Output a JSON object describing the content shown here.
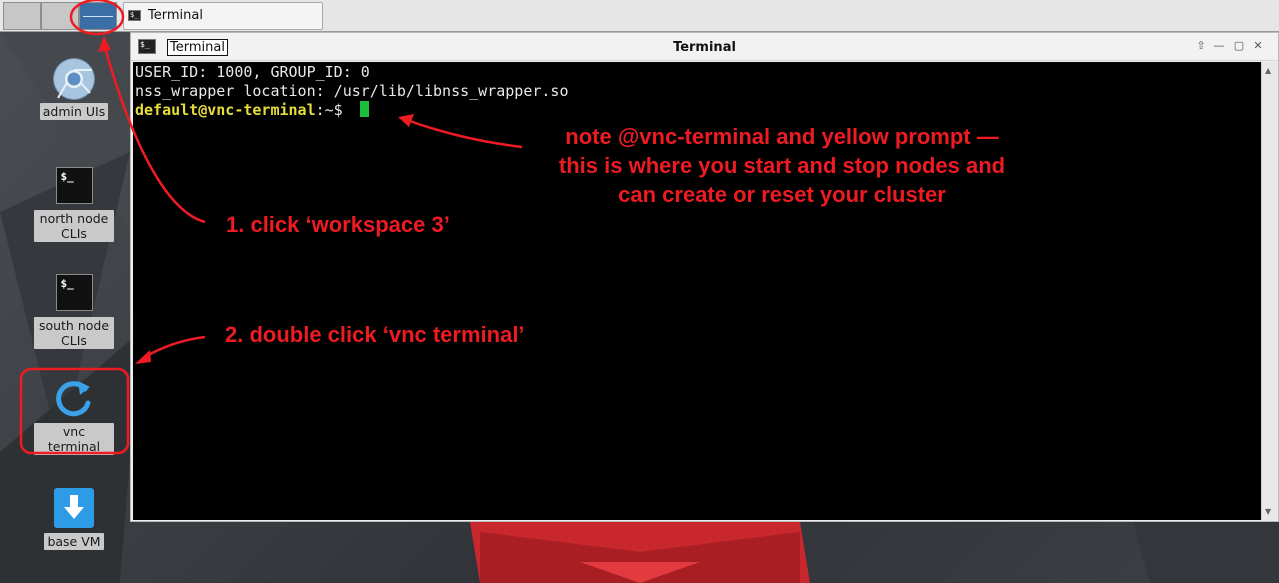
{
  "taskbar": {
    "workspaces": [
      "workspace 1",
      "workspace 2",
      "workspace 3"
    ],
    "task_label": "Terminal"
  },
  "desktop_icons": [
    {
      "label": "admin UIs",
      "icon": "chrome-icon"
    },
    {
      "label": "north node CLIs",
      "icon": "terminal-icon"
    },
    {
      "label": "south node CLIs",
      "icon": "terminal-icon"
    },
    {
      "label": "vnc terminal",
      "icon": "refresh-icon"
    },
    {
      "label": "base VM",
      "icon": "download-icon"
    }
  ],
  "terminal_window": {
    "title_box": "Terminal",
    "title_center": "Terminal",
    "lines": [
      "USER_ID: 1000, GROUP_ID: 0",
      "nss_wrapper location: /usr/lib/libnss_wrapper.so"
    ],
    "prompt_user": "default@vnc-terminal",
    "prompt_path": ":~$ ",
    "term_glyph": "$_"
  },
  "annotations": {
    "step1": "1. click ‘workspace 3’",
    "step2": "2. double click ‘vnc terminal’",
    "note_line1": "note @vnc-terminal and yellow prompt —",
    "note_line2": "this is where you start and stop nodes and",
    "note_line3": "can create or reset your cluster"
  },
  "colors": {
    "annotation_red": "#ee1b22",
    "prompt_yellow": "#e6dd3a",
    "cursor_green": "#1bbd3a",
    "workspace_active": "#3b6ea5"
  }
}
